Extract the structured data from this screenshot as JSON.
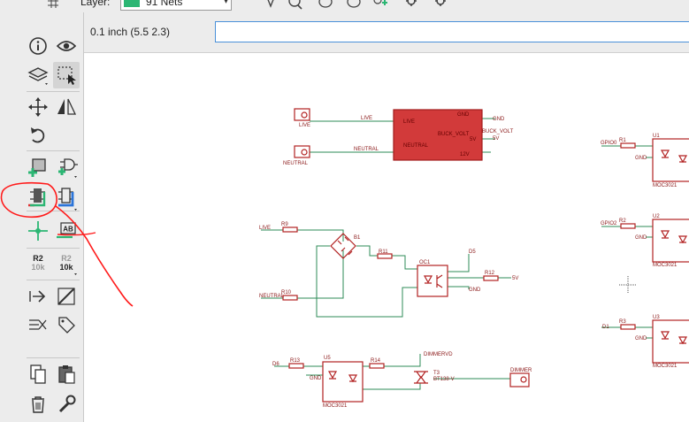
{
  "toolbar": {
    "layer_label": "Layer:",
    "layer_value": "91 Nets",
    "layer_color": "#2bb673"
  },
  "command_bar": {
    "coordinate": "0.1 inch (5.5 2.3)",
    "command_value": ""
  },
  "tools": {
    "resistor_r2": {
      "top": "R2",
      "bottom": "10k"
    },
    "value_r2": {
      "top": "R2",
      "bottom": "10k"
    },
    "label_ab": "AB"
  },
  "schematic": {
    "colors": {
      "net": "#2e8b57",
      "part": "#b22222",
      "fill": "#d23a3a"
    },
    "labels": {
      "j_live": "LIVE",
      "j_neutral": "NEUTRAL",
      "net_live": "LIVE",
      "net_neutral": "NEUTRAL",
      "ps_live": "LIVE",
      "ps_neutral": "NEUTRAL",
      "ps_gnd": "GND",
      "ps_buck": "BUCK_VOLT",
      "ps_5v": "5V",
      "ps_12v": "12V",
      "out_gnd": "GND",
      "out_buck": "BUCK_VOLT",
      "out_5v": "5V",
      "r9": "R9",
      "r10": "R10",
      "r11": "R11",
      "r12": "R12",
      "r13": "R13",
      "r14": "R14",
      "b1": "B1",
      "oc1": "OC1",
      "live2": "LIVE",
      "neutral2": "NEUTRAL",
      "d5": "D5",
      "gnd_oc": "GND",
      "v5_oc": "5V",
      "d6": "D6",
      "gnd_u5": "GND",
      "u5": "U5",
      "moc_u5": "MOC3021",
      "dimmervd": "DIMMERVD",
      "t3": "T3",
      "bt": "BT138-V",
      "dimmer": "DIMMER",
      "gpio0": "GPIO0",
      "r1": "R1",
      "u1": "U1",
      "gnd_u1": "GND",
      "moc_u1": "MOC3021",
      "gpio2": "GPIO2",
      "r2": "R2",
      "u2": "U2",
      "gnd_u2": "GND",
      "moc_u2": "MOC3021",
      "d1": "D1",
      "r3": "R3",
      "u3": "U3",
      "gnd_u3": "GND",
      "moc_u3": "MOC3021"
    }
  }
}
